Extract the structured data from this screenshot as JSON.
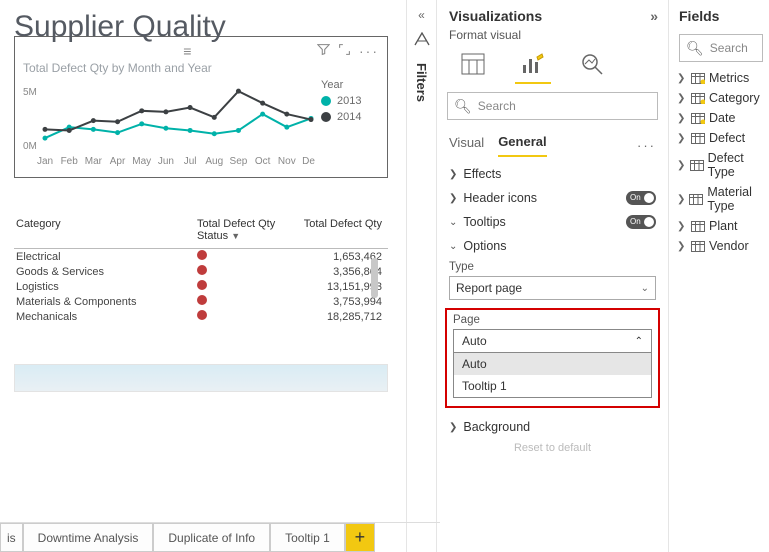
{
  "report": {
    "title": "Supplier Quality"
  },
  "chart": {
    "title": "Total Defect Qty by Month and Year",
    "legend_title": "Year"
  },
  "chart_data": {
    "type": "line",
    "categories": [
      "Jan",
      "Feb",
      "Mar",
      "Apr",
      "May",
      "Jun",
      "Jul",
      "Aug",
      "Sep",
      "Oct",
      "Nov",
      "Dec"
    ],
    "series": [
      {
        "name": "2013",
        "color": "#00B2A9",
        "values": [
          1000000,
          2000000,
          1800000,
          1500000,
          2300000,
          1900000,
          1700000,
          1400000,
          1700000,
          3200000,
          2000000,
          2800000
        ]
      },
      {
        "name": "2014",
        "color": "#3c4043",
        "values": [
          1800000,
          1700000,
          2600000,
          2500000,
          3500000,
          3400000,
          3800000,
          2900000,
          5300000,
          4200000,
          3200000,
          2700000
        ]
      }
    ],
    "yticks": [
      0,
      5000000
    ],
    "ytick_labels": [
      "0M",
      "5M"
    ],
    "ylim": [
      0,
      5500000
    ]
  },
  "table": {
    "columns": [
      "Category",
      "Total Defect Qty Status",
      "Total Defect Qty"
    ],
    "rows": [
      {
        "category": "Electrical",
        "qty": "1,653,462"
      },
      {
        "category": "Goods & Services",
        "qty": "3,356,864"
      },
      {
        "category": "Logistics",
        "qty": "13,151,993"
      },
      {
        "category": "Materials & Components",
        "qty": "3,753,994"
      },
      {
        "category": "Mechanicals",
        "qty": "18,285,712"
      }
    ]
  },
  "tabs": {
    "cut": "is",
    "t1": "Downtime Analysis",
    "t2": "Duplicate of Info",
    "t3": "Tooltip 1",
    "add": "+"
  },
  "filters_label": "Filters",
  "viz": {
    "header": "Visualizations",
    "sub": "Format visual",
    "search_ph": "Search",
    "seg_visual": "Visual",
    "seg_general": "General",
    "sect_effects": "Effects",
    "sect_header_icons": "Header icons",
    "sect_tooltips": "Tooltips",
    "sect_options": "Options",
    "type_label": "Type",
    "type_value": "Report page",
    "page_label": "Page",
    "page_selected": "Auto",
    "page_opts": [
      "Auto",
      "Tooltip 1"
    ],
    "sect_background": "Background",
    "reset": "Reset to default",
    "on": "On"
  },
  "fields": {
    "header": "Fields",
    "search_ph": "Search",
    "items": [
      "Metrics",
      "Category",
      "Date",
      "Defect",
      "Defect Type",
      "Material Type",
      "Plant",
      "Vendor"
    ]
  }
}
